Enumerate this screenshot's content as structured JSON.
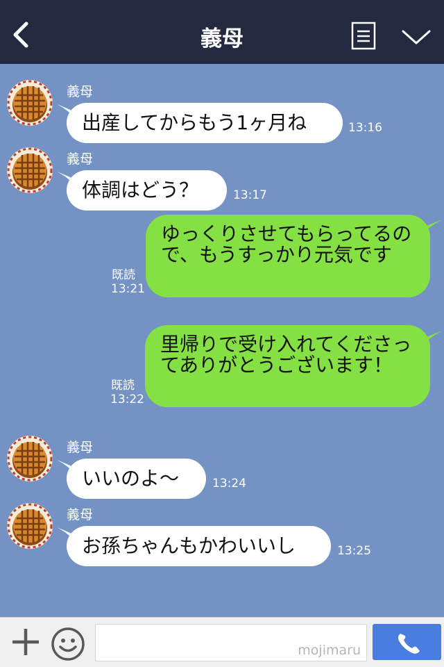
{
  "header": {
    "title": "義母",
    "back_icon": "chevron-left-icon",
    "menu_icon": "note-icon",
    "more_icon": "chevron-down-icon",
    "bg_color": "#232a3f"
  },
  "chat": {
    "bg_color": "#7493c4",
    "messages": [
      {
        "sender": "義母",
        "text": "出産してからもう1ヶ月ね",
        "time": "13:16"
      },
      {
        "sender": "義母",
        "text": "体調はどう？",
        "time": "13:17"
      },
      {
        "text": "ゆっくりさせてもらってるので、もうすっかり元気です",
        "read": "既読",
        "time": "13:21"
      },
      {
        "text": "里帰りで受け入れてくださってありがとうございます！",
        "read": "既読",
        "time": "13:22"
      },
      {
        "sender": "義母",
        "text": "いいのよ〜",
        "time": "13:24"
      },
      {
        "sender": "義母",
        "text": "お孫ちゃんもかわいいし",
        "time": "13:25"
      }
    ]
  },
  "input_bar": {
    "watermark": "mojimaru",
    "plus_icon": "plus-icon",
    "emoji_icon": "smiley-icon",
    "call_icon": "phone-icon",
    "call_color": "#4a7de0"
  },
  "colors": {
    "incoming_bubble": "#ffffff",
    "outgoing_bubble": "#84e043"
  }
}
